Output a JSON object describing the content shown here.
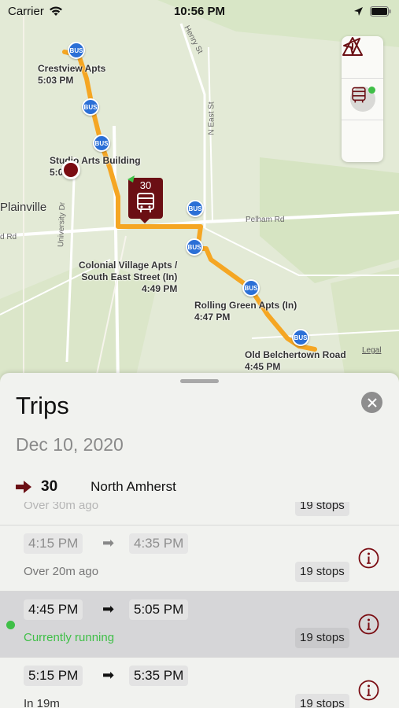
{
  "status_bar": {
    "carrier": "Carrier",
    "time": "10:56 PM"
  },
  "map": {
    "town": "Plainville",
    "streets": [
      "Henry St",
      "N East St",
      "Pelham Rd",
      "University Dr",
      "d Rd"
    ],
    "stops": [
      {
        "name": "Crestview Apts",
        "time": "5:03 PM"
      },
      {
        "name": "Studio Arts Building",
        "time": "5:0"
      },
      {
        "name": "Colonial Village Apts /",
        "name2": "South East Street (In)",
        "time": "4:49 PM"
      },
      {
        "name": "Rolling Green Apts (In)",
        "time": "4:47 PM"
      },
      {
        "name": "Old Belchertown Road",
        "time": "4:45 PM"
      }
    ],
    "bus_stop_label": "BUS",
    "vehicle_number": "30",
    "legal": "Legal",
    "route_color": "#f5a623"
  },
  "controls": {
    "locate": "location-arrow-icon",
    "bus": "bus-icon",
    "alert": "warning-icon"
  },
  "sheet": {
    "title": "Trips",
    "date": "Dec 10, 2020",
    "route_number": "30",
    "route_name": "North Amherst",
    "partial_top": {
      "status": "Over 30m ago",
      "stops": "19 stops"
    },
    "trips": [
      {
        "depart": "4:15 PM",
        "arrive": "4:35 PM",
        "status": "Over 20m ago",
        "stops": "19 stops",
        "state": "past"
      },
      {
        "depart": "4:45 PM",
        "arrive": "5:05 PM",
        "status": "Currently running",
        "stops": "19 stops",
        "state": "active"
      },
      {
        "depart": "5:15 PM",
        "arrive": "5:35 PM",
        "status": "In 19m",
        "stops": "19 stops",
        "state": "future"
      }
    ]
  },
  "colors": {
    "accent": "#6b0f14",
    "running": "#3fbf47",
    "bus_stop": "#2b6fd6"
  }
}
